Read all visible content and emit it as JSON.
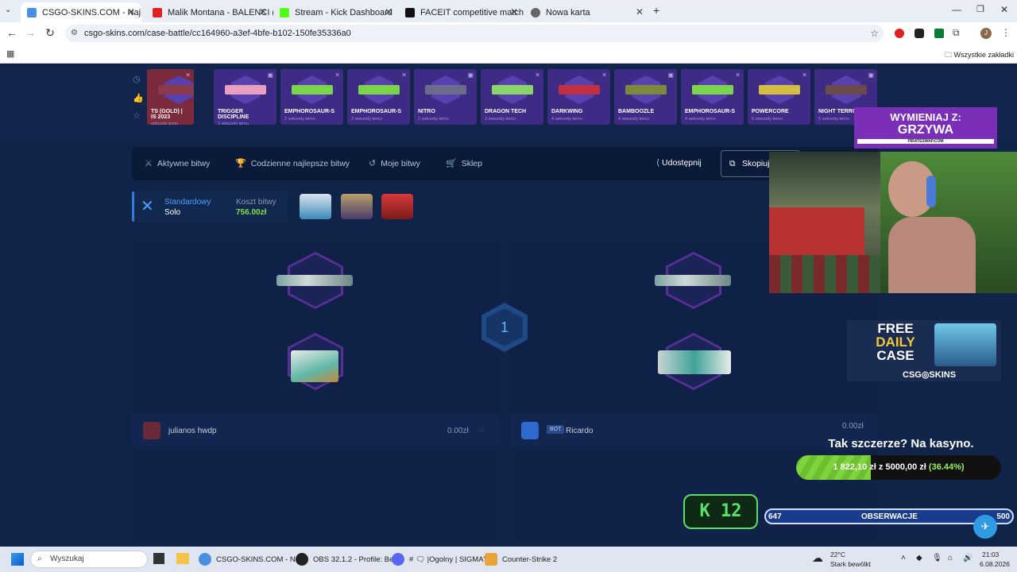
{
  "browser": {
    "tabs": [
      {
        "title": "CSGO-SKINS.COM - Najlep",
        "active": true,
        "color": "#4a90e2"
      },
      {
        "title": "Malik Montana - BALENCI (prod",
        "active": false,
        "color": "#e02020"
      },
      {
        "title": "Stream - Kick Dashboard",
        "active": false,
        "color": "#53fc18"
      },
      {
        "title": "FACEIT competitive match - FAC",
        "active": false,
        "color": "#111111"
      },
      {
        "title": "Nowa karta",
        "active": false,
        "color": "#666666"
      }
    ],
    "url": "csgo-skins.com/case-battle/cc164960-a3ef-4bfe-b102-150fe35336a0",
    "bookmarks_folder": "Wszystkie zakładki"
  },
  "live_drops": [
    {
      "name": "TS (GOLD) |",
      "name2": "IS 2023",
      "time": "sekundy temu",
      "color": "#8b3a4a"
    },
    {
      "name": "TRIGGER",
      "name2": "DISCIPLINE",
      "time": "2 sekundy temu",
      "color": "#e9a0c0"
    },
    {
      "name": "EMPHOROSAUR-S",
      "time": "2 sekundy temu",
      "color": "#7cd44a"
    },
    {
      "name": "EMPHOROSAUR-S",
      "time": "2 sekundy temu",
      "color": "#7cd44a"
    },
    {
      "name": "NITRO",
      "time": "2 sekundy temu",
      "color": "#6b6b8c"
    },
    {
      "name": "DRAGON TECH",
      "time": "3 sekundy temu",
      "color": "#8bd46a"
    },
    {
      "name": "DARKWING",
      "time": "4 sekundy temu",
      "color": "#c03040"
    },
    {
      "name": "BAMBOOZLE",
      "time": "4 sekundy temu",
      "color": "#7a8a3a"
    },
    {
      "name": "EMPHOROSAUR-S",
      "time": "4 sekundy temu",
      "color": "#7cd44a"
    },
    {
      "name": "POWERCORE",
      "time": "5 sekundy temu",
      "color": "#d4c040"
    },
    {
      "name": "NIGHT TERROR",
      "time": "5 sekundy temu",
      "color": "#6b4a4a"
    }
  ],
  "menu": {
    "active_battles": "Aktywne bitwy",
    "daily_best": "Codzienne najlepsze bitwy",
    "my_battles": "Moje bitwy",
    "shop": "Sklep",
    "share": "Udostępnij",
    "copy": "Skopiuj"
  },
  "battle": {
    "mode": "Standardowy",
    "type": "Solo",
    "cost_label": "Koszt bitwy",
    "cost": "756.00zł",
    "round": "1"
  },
  "players": [
    {
      "name": "julianos hwdp",
      "amount": "0.00zł",
      "bot": false
    },
    {
      "name": "Ricardo",
      "amount": "0.00zł",
      "bot": true,
      "bot_label": "BOT"
    }
  ],
  "overlay": {
    "ad1_line1": "WYMIENIAJ Z:",
    "ad1_line2": "GRZYWA",
    "ad1_line3": "PIRATESWAP.COM",
    "ad2_line1": "FREE",
    "ad2_line2": "DAILY",
    "ad2_line3": "CASE",
    "ad2_brand": "CSG◎SKINS",
    "promo_title": "Tak szczerze? Na kasyno.",
    "goal_current": "1 822,10 zł",
    "goal_sep": " z ",
    "goal_target": "5000,00 zł",
    "goal_percent": "(36.44%)",
    "goal_fraction": 0.3644,
    "kick_label": "K",
    "kick_count": "12",
    "obs_left": "647",
    "obs_label": "OBSERWACJE",
    "obs_right": "500"
  },
  "taskbar": {
    "search": "Wyszukaj",
    "items": [
      {
        "label": "CSGO-SKINS.COM - Naj",
        "color": "#4a90e2"
      },
      {
        "label": "OBS 32.1.2 - Profile: Bez",
        "color": "#222222"
      },
      {
        "label": "# 🗨 |Ogolny | SIGMA'S",
        "color": "#5865f2"
      },
      {
        "label": "Counter-Strike 2",
        "color": "#e8a33a"
      }
    ],
    "weather_temp": "22°C",
    "weather_desc": "Stark bewölkt",
    "time": "21:03",
    "date": "6.08.2026"
  }
}
